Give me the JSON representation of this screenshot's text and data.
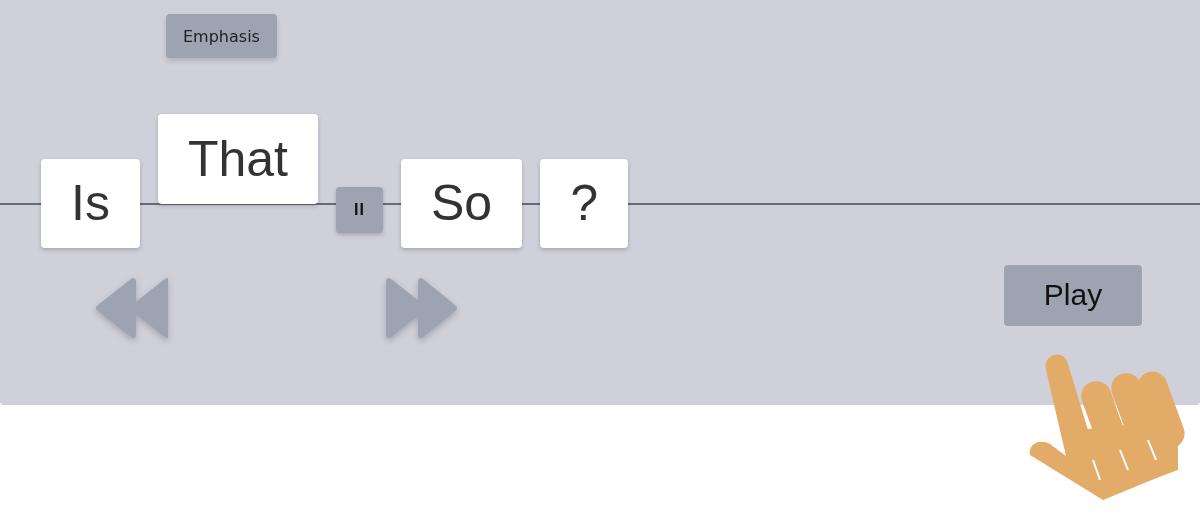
{
  "emphasis_button": {
    "label": "Emphasis"
  },
  "phrase": [
    {
      "kind": "word",
      "text": "Is",
      "raised": false
    },
    {
      "kind": "word",
      "text": "That",
      "raised": true
    },
    {
      "kind": "pause",
      "text": "II"
    },
    {
      "kind": "word",
      "text": "So",
      "raised": false
    },
    {
      "kind": "word",
      "text": "?",
      "raised": false
    }
  ],
  "play_button": {
    "label": "Play"
  }
}
